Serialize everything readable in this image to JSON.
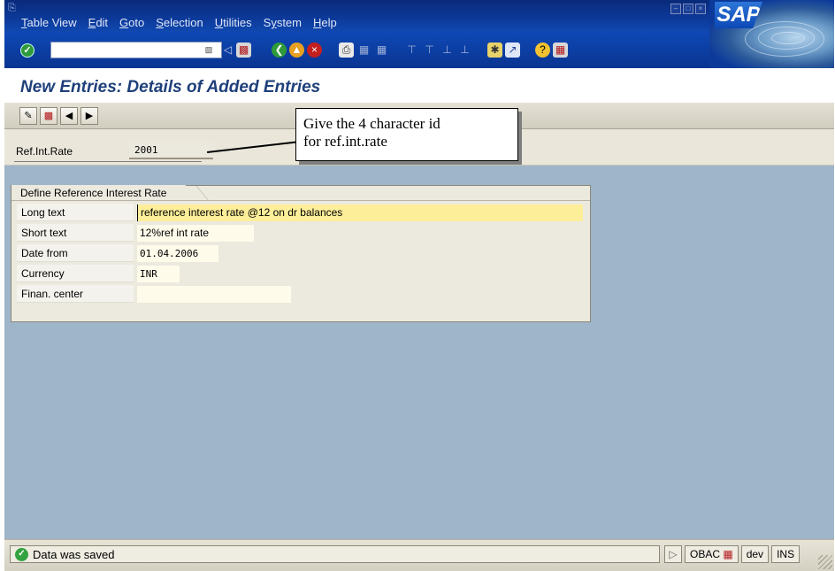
{
  "menu": [
    {
      "label": "Table View",
      "accel": "T"
    },
    {
      "label": "Edit",
      "accel": "E"
    },
    {
      "label": "Goto",
      "accel": "G"
    },
    {
      "label": "Selection",
      "accel": "S"
    },
    {
      "label": "Utilities",
      "accel": "U"
    },
    {
      "label": "System",
      "accel": "y"
    },
    {
      "label": "Help",
      "accel": "H"
    }
  ],
  "brand": {
    "logo_text": "SAP"
  },
  "screen_title": "New Entries: Details of Added Entries",
  "header": {
    "ref_int_rate_label": "Ref.Int.Rate",
    "ref_int_rate_value": "2001"
  },
  "group": {
    "title": "Define Reference Interest Rate",
    "fields": [
      {
        "label": "Long text",
        "value": "reference interest rate @12 on dr balances"
      },
      {
        "label": "Short text",
        "value": "12%ref int rate"
      },
      {
        "label": "Date from",
        "value": "01.04.2006"
      },
      {
        "label": "Currency",
        "value": "INR"
      },
      {
        "label": "Finan. center",
        "value": ""
      }
    ]
  },
  "callout": {
    "line1": "Give the 4 character id",
    "line2": "for ref.int.rate"
  },
  "status": {
    "message": "Data was saved",
    "system": "OBAC",
    "client": "dev",
    "mode": "INS"
  },
  "colors": {
    "menu_bar": "#0c3a9a",
    "screen_title": "#1e3f7a",
    "work_area": "#9fb5c9",
    "focused_field": "#fdee9a"
  }
}
